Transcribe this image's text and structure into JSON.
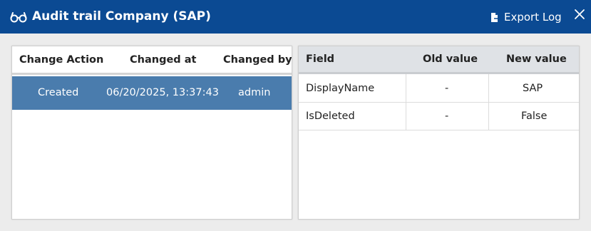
{
  "window": {
    "title": "Audit trail Company (SAP)",
    "title_icon": "glasses-icon",
    "export_label": "Export Log",
    "export_icon": "file-export-icon",
    "close_icon": "close-icon",
    "accent_color": "#0b4a93",
    "selected_row_color": "#4a7cad"
  },
  "changes": {
    "columns": [
      "Change Action",
      "Changed at",
      "Changed by"
    ],
    "rows": [
      {
        "action": "Created",
        "changed_at": "06/20/2025, 13:37:43",
        "changed_by": "admin"
      }
    ]
  },
  "details": {
    "columns": [
      "Field",
      "Old value",
      "New value"
    ],
    "rows": [
      {
        "field": "DisplayName",
        "old": "-",
        "new": "SAP"
      },
      {
        "field": "IsDeleted",
        "old": "-",
        "new": "False"
      }
    ]
  }
}
